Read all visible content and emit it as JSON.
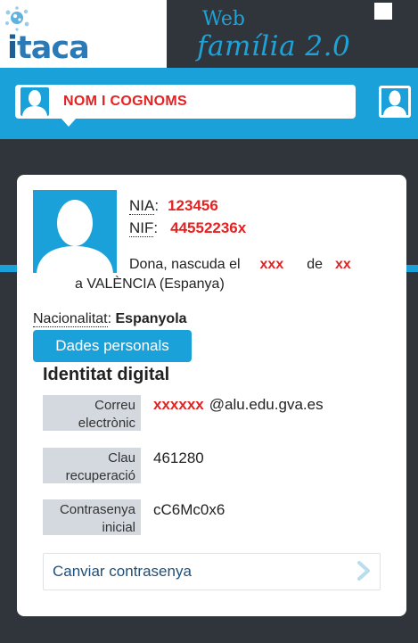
{
  "header": {
    "logo_text_i": "i",
    "logo_text_rest": "taca",
    "web_label": "Web",
    "app_title": "família 2.0"
  },
  "user_strip": {
    "user_name": "NOM I COGNOMS"
  },
  "profile": {
    "nia_label": "NIA",
    "nia_colon": ":",
    "nia_value": "123456",
    "nif_label": "NIF",
    "nif_colon": ":",
    "nif_value": "44552236x",
    "born_text": "Dona, nascuda el",
    "born_date": "xxx",
    "born_de": "de",
    "born_month": "xx",
    "birthplace": "a VALÈNCIA (Espanya)",
    "nationality_label": "Nacionalitat",
    "nationality_colon": ": ",
    "nationality_value": "Espanyola"
  },
  "tabs": {
    "personal_data": "Dades personals"
  },
  "digital_identity": {
    "title": "Identitat digital",
    "email_label_line1": "Correu",
    "email_label_line2": "electrònic",
    "email_user": "xxxxxx",
    "email_domain": "@alu.edu.gva.es",
    "recovery_label_line1": "Clau",
    "recovery_label_line2": "recuperació",
    "recovery_value": "461280",
    "password_label_line1": "Contrasenya",
    "password_label_line2": "inicial",
    "password_value": "cC6Mc0x6",
    "change_password": "Canviar contrasenya"
  },
  "colors": {
    "accent_blue": "#1ba1da",
    "dark_bg": "#2f353b",
    "highlight_red": "#e32222"
  },
  "icons": {
    "logo": "itaca-logo-icon",
    "user_avatar": "user-silhouette-icon",
    "chevron": "chevron-right-icon"
  }
}
